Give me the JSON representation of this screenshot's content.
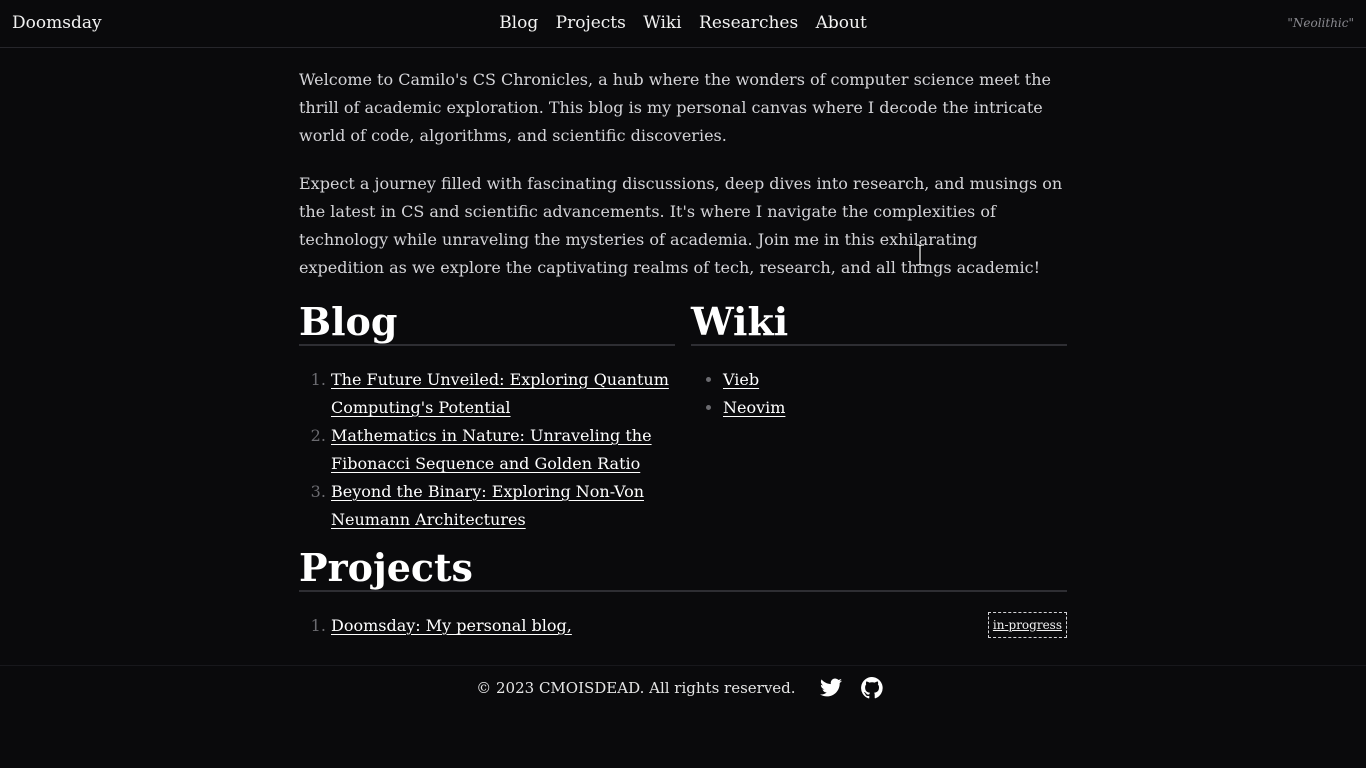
{
  "header": {
    "brand": "Doomsday",
    "nav": [
      "Blog",
      "Projects",
      "Wiki",
      "Researches",
      "About"
    ],
    "tagline": "\"Neolithic\""
  },
  "intro": {
    "p1": "Welcome to Camilo's CS Chronicles, a hub where the wonders of computer science meet the thrill of academic exploration. This blog is my personal canvas where I decode the intricate world of code, algorithms, and scientific discoveries.",
    "p2": "Expect a journey filled with fascinating discussions, deep dives into research, and musings on the latest in CS and scientific advancements. It's where I navigate the complexities of technology while unraveling the mysteries of academia. Join me in this exhilarating expedition as we explore the captivating realms of tech, research, and all things academic!"
  },
  "blog": {
    "title": "Blog",
    "items": [
      "The Future Unveiled: Exploring Quantum Computing's Potential",
      "Mathematics in Nature: Unraveling the Fibonacci Sequence and Golden Ratio",
      "Beyond the Binary: Exploring Non-Von Neumann Architectures"
    ]
  },
  "wiki": {
    "title": "Wiki",
    "items": [
      "Vieb",
      "Neovim"
    ]
  },
  "projects": {
    "title": "Projects",
    "items": [
      {
        "label": "Doomsday: My personal blog,",
        "status": "in-progress"
      }
    ]
  },
  "footer": {
    "copyright": "© 2023 CMOISDEAD. All rights reserved.",
    "icons": [
      "twitter-icon",
      "github-icon"
    ]
  }
}
